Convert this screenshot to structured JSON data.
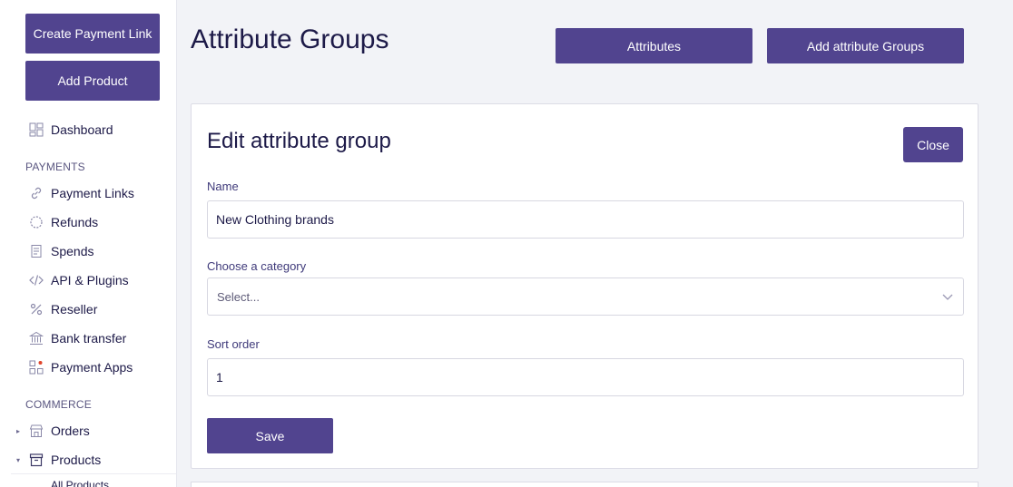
{
  "sidebar": {
    "create_payment_link": "Create Payment Link",
    "add_product": "Add Product",
    "dashboard": "Dashboard",
    "payments_section": "PAYMENTS",
    "payment_links": "Payment Links",
    "refunds": "Refunds",
    "spends": "Spends",
    "api_plugins": "API & Plugins",
    "reseller": "Reseller",
    "bank_transfer": "Bank transfer",
    "payment_apps": "Payment Apps",
    "commerce_section": "COMMERCE",
    "orders": "Orders",
    "products": "Products",
    "all_products": "All Products"
  },
  "header": {
    "title": "Attribute Groups",
    "attributes_btn": "Attributes",
    "add_groups_btn": "Add attribute Groups"
  },
  "form": {
    "title": "Edit attribute group",
    "close_label": "Close",
    "name_label": "Name",
    "name_value": "New Clothing brands",
    "category_label": "Choose a category",
    "category_placeholder": "Select...",
    "sort_label": "Sort order",
    "sort_value": "1",
    "save_label": "Save"
  },
  "colors": {
    "accent": "#51448f",
    "text": "#1d1a48",
    "notification_dot": "#e0452b"
  }
}
